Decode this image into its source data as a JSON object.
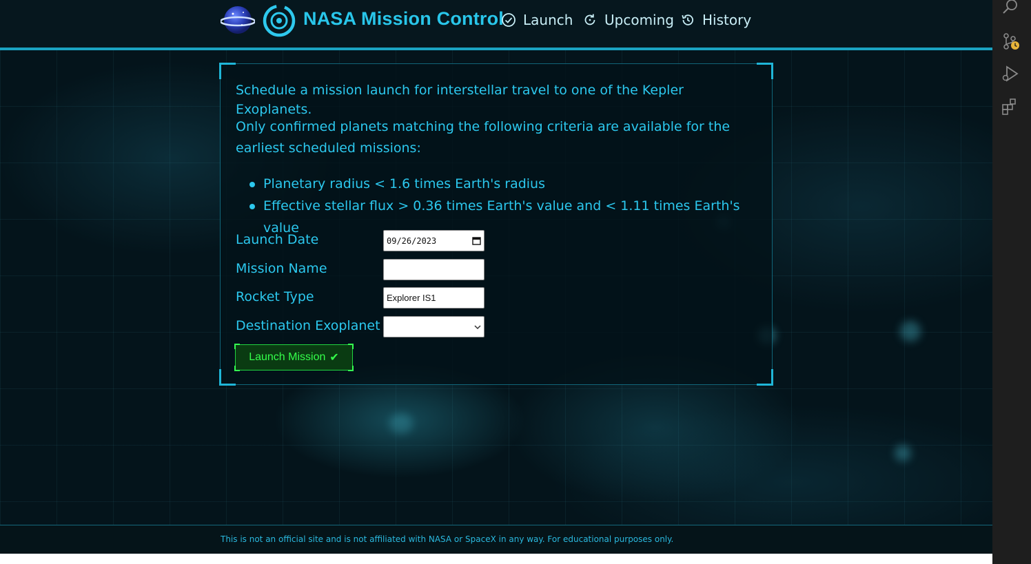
{
  "header": {
    "brand": "NASA Mission Control",
    "nav": [
      {
        "label": "Launch",
        "icon": "check-circle-icon"
      },
      {
        "label": "Upcoming",
        "icon": "refresh-icon"
      },
      {
        "label": "History",
        "icon": "history-icon"
      }
    ]
  },
  "panel": {
    "intro": "Schedule a mission launch for interstellar travel to one of the Kepler Exoplanets.",
    "criteria_intro": "Only confirmed planets matching the following criteria are available for the earliest scheduled missions:",
    "criteria": [
      "Planetary radius < 1.6 times Earth's radius",
      "Effective stellar flux > 0.36 times Earth's value and < 1.11 times Earth's value"
    ]
  },
  "form": {
    "launch_date_label": "Launch Date",
    "launch_date_value": "09/26/2023",
    "mission_name_label": "Mission Name",
    "mission_name_value": "",
    "rocket_type_label": "Rocket Type",
    "rocket_type_value": "Explorer IS1",
    "destination_label": "Destination Exoplanet",
    "destination_value": "",
    "submit_label": "Launch Mission",
    "submit_glyph": "✔"
  },
  "footer": {
    "text": "This is not an official site and is not affiliated with NASA or SpaceX in any way. For educational purposes only."
  },
  "colors": {
    "accent": "#29c6ea",
    "background": "#04141b",
    "button_green": "#34ff4a"
  },
  "activity_bar": {
    "icons": [
      "search-icon",
      "source-control-icon",
      "run-debug-icon",
      "extensions-icon"
    ]
  }
}
